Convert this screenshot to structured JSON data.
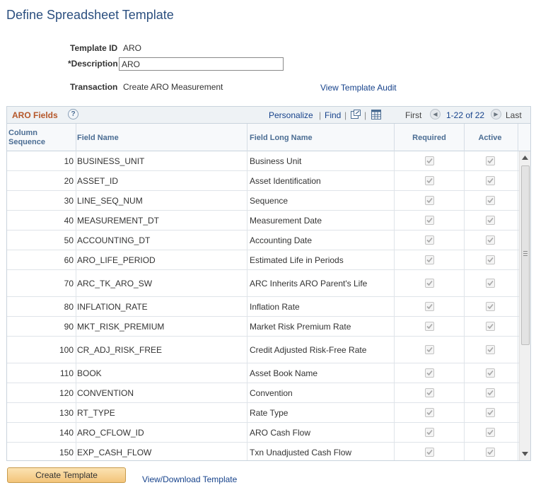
{
  "page": {
    "title": "Define Spreadsheet Template"
  },
  "form": {
    "template_id_label": "Template ID",
    "template_id_value": "ARO",
    "description_label": "*Description",
    "description_value": "ARO",
    "transaction_label": "Transaction",
    "transaction_value": "Create ARO Measurement",
    "audit_link": "View Template Audit"
  },
  "grid": {
    "title": "ARO Fields",
    "help": "?",
    "personalize": "Personalize",
    "find": "Find",
    "sep": "|",
    "first": "First",
    "range": "1-22 of 22",
    "last": "Last",
    "columns": {
      "seq": "Column Sequence",
      "field": "Field Name",
      "long": "Field Long Name",
      "required": "Required",
      "active": "Active"
    },
    "rows": [
      {
        "seq": "10",
        "field": "BUSINESS_UNIT",
        "long": "Business Unit",
        "required": true,
        "active": true
      },
      {
        "seq": "20",
        "field": "ASSET_ID",
        "long": "Asset Identification",
        "required": true,
        "active": true
      },
      {
        "seq": "30",
        "field": "LINE_SEQ_NUM",
        "long": "Sequence",
        "required": true,
        "active": true
      },
      {
        "seq": "40",
        "field": "MEASUREMENT_DT",
        "long": "Measurement Date",
        "required": true,
        "active": true
      },
      {
        "seq": "50",
        "field": "ACCOUNTING_DT",
        "long": "Accounting Date",
        "required": true,
        "active": true
      },
      {
        "seq": "60",
        "field": "ARO_LIFE_PERIOD",
        "long": "Estimated Life in Periods",
        "required": true,
        "active": true
      },
      {
        "seq": "70",
        "field": "ARC_TK_ARO_SW",
        "long": "ARC Inherits ARO Parent's Life",
        "required": true,
        "active": true
      },
      {
        "seq": "80",
        "field": "INFLATION_RATE",
        "long": "Inflation Rate",
        "required": true,
        "active": true
      },
      {
        "seq": "90",
        "field": "MKT_RISK_PREMIUM",
        "long": "Market Risk Premium Rate",
        "required": true,
        "active": true
      },
      {
        "seq": "100",
        "field": "CR_ADJ_RISK_FREE",
        "long": "Credit Adjusted Risk-Free Rate",
        "required": true,
        "active": true
      },
      {
        "seq": "110",
        "field": "BOOK",
        "long": "Asset Book Name",
        "required": true,
        "active": true
      },
      {
        "seq": "120",
        "field": "CONVENTION",
        "long": "Convention",
        "required": true,
        "active": true
      },
      {
        "seq": "130",
        "field": "RT_TYPE",
        "long": "Rate Type",
        "required": true,
        "active": true
      },
      {
        "seq": "140",
        "field": "ARO_CFLOW_ID",
        "long": "ARO Cash Flow",
        "required": true,
        "active": true
      },
      {
        "seq": "150",
        "field": "EXP_CASH_FLOW",
        "long": "Txn Unadjusted Cash Flow",
        "required": true,
        "active": true
      }
    ]
  },
  "actions": {
    "create_template": "Create Template",
    "view_download": "View/Download Template"
  },
  "colors": {
    "title": "#2b4f7f",
    "link": "#16428b",
    "grid_title": "#b5572a",
    "button": "#f3c47a"
  }
}
